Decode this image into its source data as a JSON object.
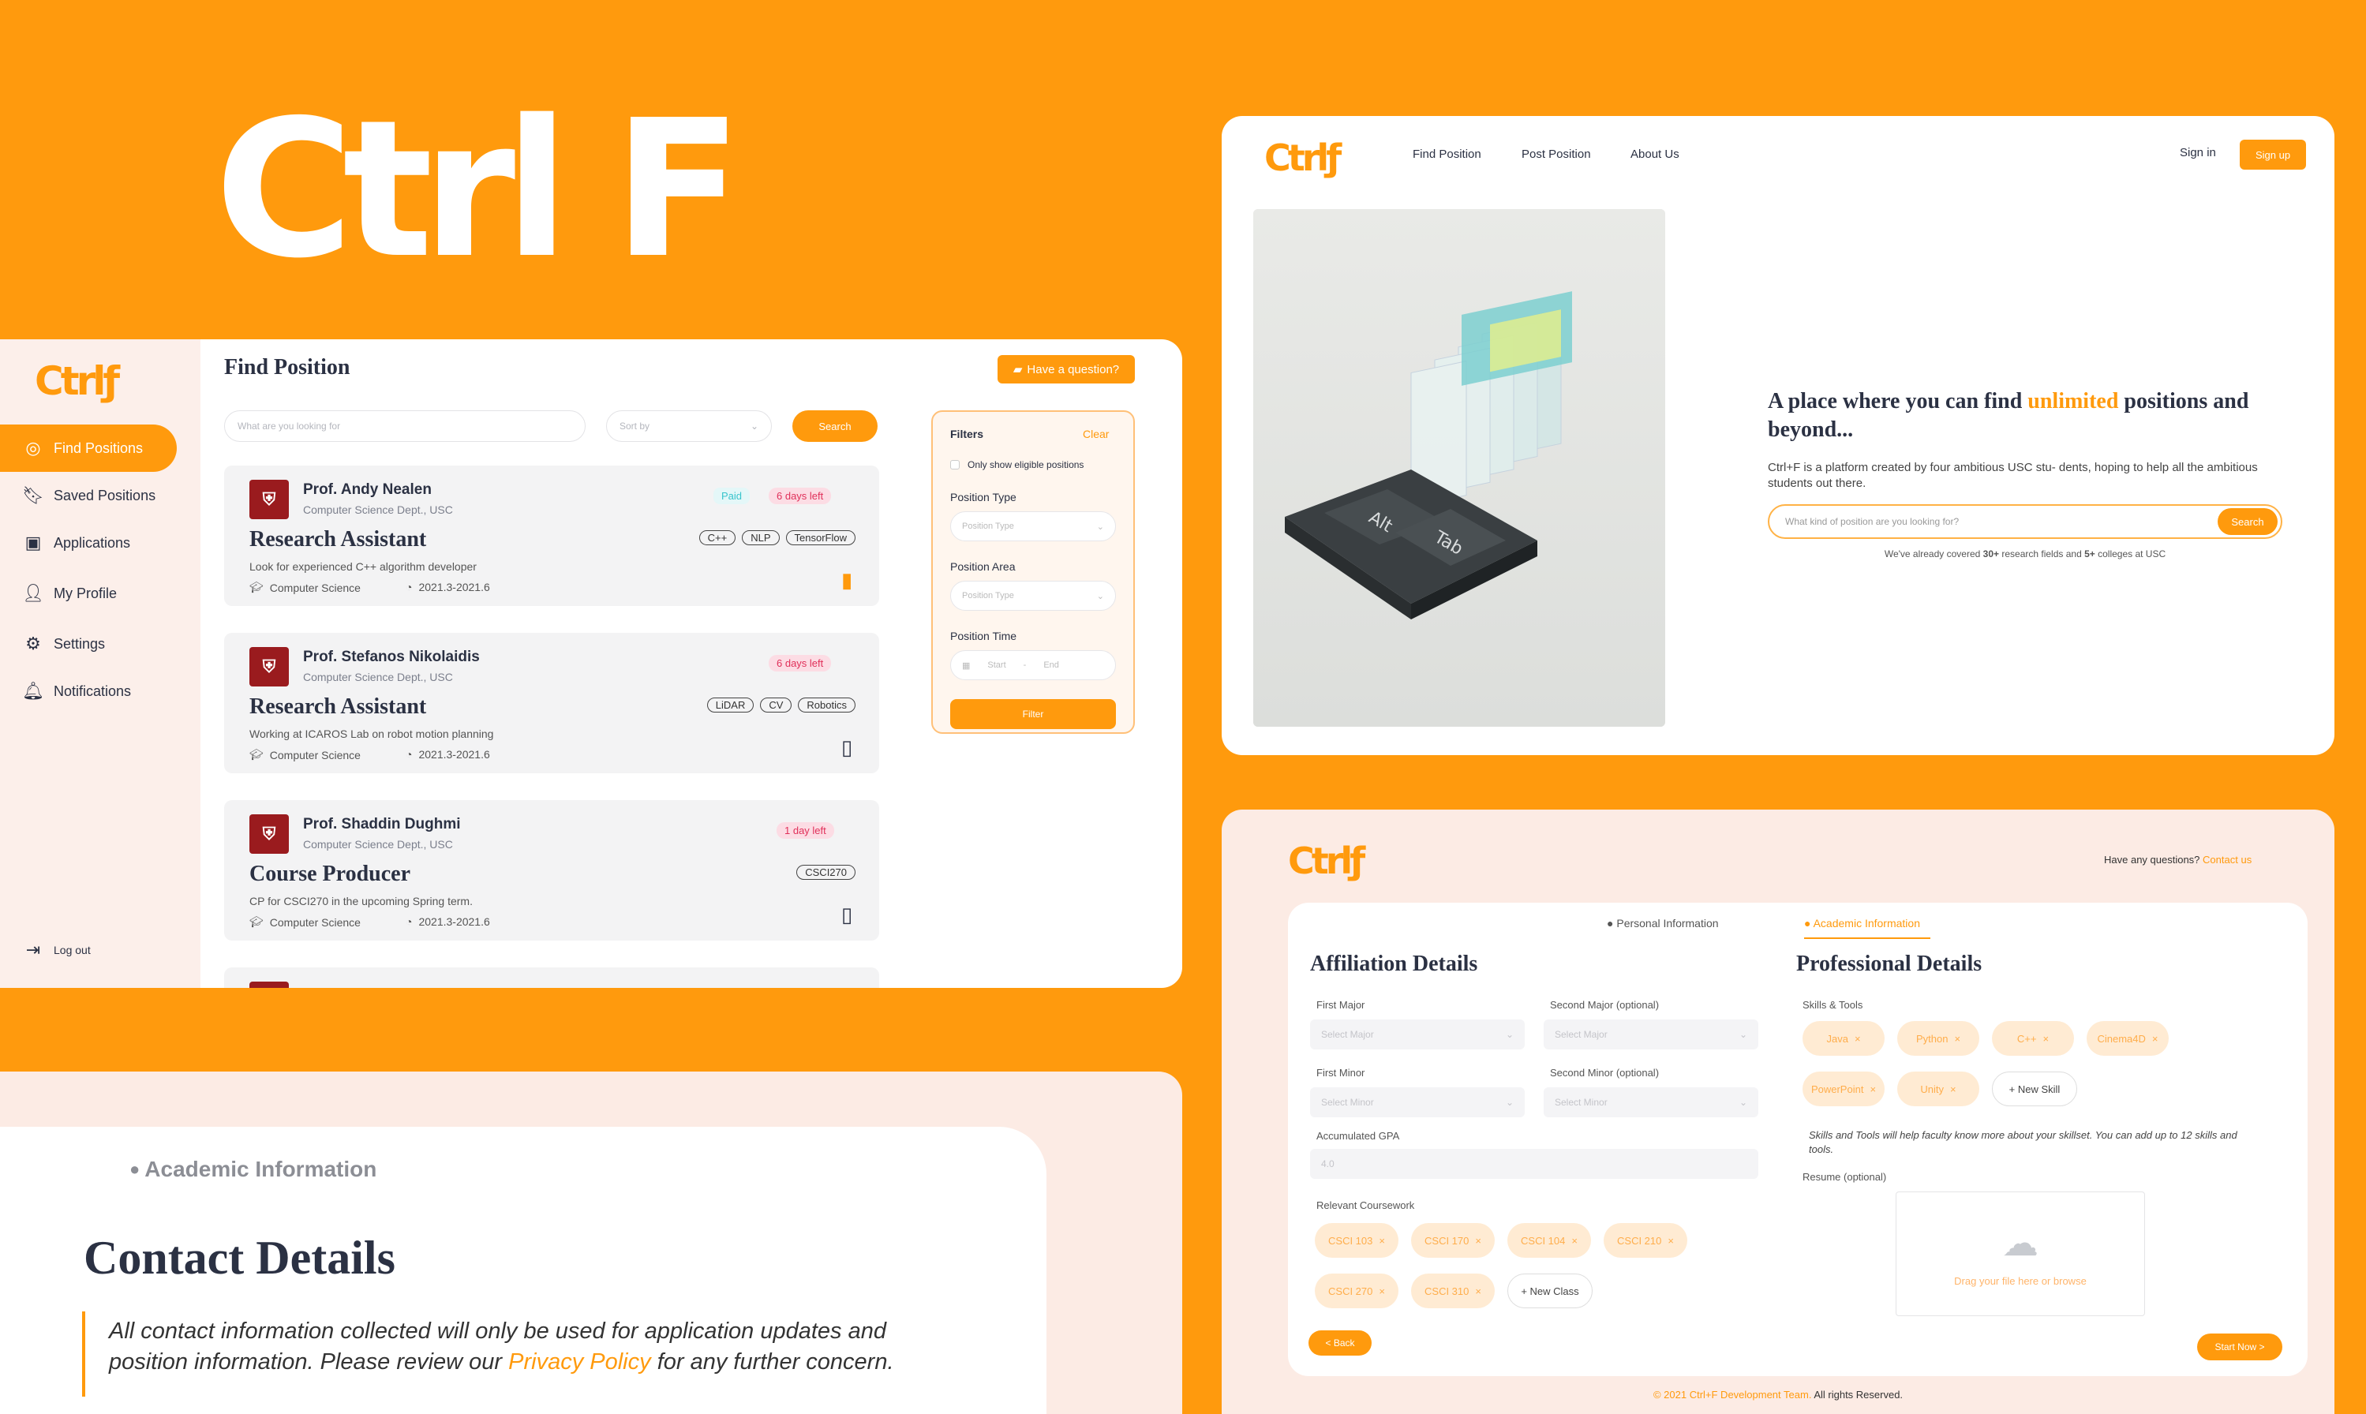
{
  "brand": {
    "logo": "Ctrl F",
    "small_logo": "Ctrlƒ"
  },
  "colors": {
    "accent": "#FF9A0D",
    "ink": "#2B3143",
    "paid": "#38C4CC",
    "urgent": "#E0305A"
  },
  "find_app": {
    "sidebar": [
      {
        "icon": "target-icon",
        "label": "Find Positions"
      },
      {
        "icon": "bookmark-icon",
        "label": "Saved Positions"
      },
      {
        "icon": "document-check-icon",
        "label": "Applications"
      },
      {
        "icon": "user-icon",
        "label": "My Profile"
      },
      {
        "icon": "gear-icon",
        "label": "Settings"
      },
      {
        "icon": "bell-icon",
        "label": "Notifications"
      }
    ],
    "logout": "Log out",
    "title": "Find Position",
    "ask_button": "Have a question?",
    "search_placeholder": "What are you looking for",
    "sort_placeholder": "Sort by",
    "search_button": "Search",
    "positions": [
      {
        "prof": "Prof. Andy Nealen",
        "dept": "Computer Science Dept., USC",
        "role": "Research Assistant",
        "desc": "Look for experienced C++ algorithm developer",
        "area": "Computer Science",
        "time": "2021.3-2021.6",
        "paid": "Paid",
        "deadline": "6 days left",
        "chips": [
          "C++",
          "NLP",
          "TensorFlow"
        ],
        "saved": true
      },
      {
        "prof": "Prof. Stefanos Nikolaidis",
        "dept": "Computer Science Dept., USC",
        "role": "Research Assistant",
        "desc": "Working at ICAROS Lab on robot motion planning",
        "area": "Computer Science",
        "time": "2021.3-2021.6",
        "paid": "",
        "deadline": "6 days left",
        "chips": [
          "LiDAR",
          "CV",
          "Robotics"
        ],
        "saved": false
      },
      {
        "prof": "Prof. Shaddin Dughmi",
        "dept": "Computer Science Dept., USC",
        "role": "Course Producer",
        "desc": "CP for CSCI270 in the upcoming Spring term.",
        "area": "Computer Science",
        "time": "2021.3-2021.6",
        "paid": "",
        "deadline": "1 day left",
        "chips": [
          "CSCI270"
        ],
        "saved": false
      }
    ],
    "filters": {
      "title": "Filters",
      "clear": "Clear",
      "eligible": "Only show eligible positions",
      "type_label": "Position Type",
      "type_placeholder": "Position Type",
      "area_label": "Position Area",
      "area_placeholder": "Position Type",
      "time_label": "Position Time",
      "start": "Start",
      "end": "End",
      "button": "Filter"
    }
  },
  "landing": {
    "nav": [
      "Find Position",
      "Post Position",
      "About Us"
    ],
    "sign_in": "Sign in",
    "sign_up": "Sign up",
    "heading_pre": "A place where you can find ",
    "heading_em": "unlimited",
    "heading_post": " positions and beyond...",
    "body": "Ctrl+F is a platform created by four ambitious USC stu- dents, hoping to help all the ambitious students out there.",
    "search_placeholder": "What kind of position are you looking for?",
    "search_button": "Search",
    "note_pre": "We've already covered ",
    "note_b1": "30+",
    "note_mid": " research fields and ",
    "note_b2": "5+",
    "note_post": " colleges at USC",
    "keys": [
      "Alt",
      "Tab"
    ]
  },
  "contact": {
    "section": "Academic Information",
    "title": "Contact Details",
    "note_pre": "All contact information collected will only be used for application updates and position information. Please review our ",
    "note_link": "Privacy Policy",
    "note_post": " for any further concern."
  },
  "academic": {
    "help": "Have any questions?",
    "help_link": "Contact us",
    "tabs": [
      "Personal Information",
      "Academic Information"
    ],
    "affiliation_title": "Affiliation Details",
    "first_major": "First Major",
    "second_major": "Second Major (optional)",
    "major_placeholder": "Select Major",
    "first_minor": "First Minor",
    "second_minor": "Second Minor (optional)",
    "minor_placeholder": "Select Minor",
    "gpa_label": "Accumulated GPA",
    "gpa_value": "4.0",
    "coursework_label": "Relevant Coursework",
    "courses": [
      "CSCI 103",
      "CSCI 170",
      "CSCI 104",
      "CSCI 210",
      "CSCI 270",
      "CSCI 310"
    ],
    "new_class": "+ New Class",
    "professional_title": "Professional Details",
    "skills_label": "Skills & Tools",
    "skills": [
      "Java",
      "Python",
      "C++",
      "Cinema4D",
      "PowerPoint",
      "Unity"
    ],
    "new_skill": "+ New Skill",
    "skills_hint": "Skills and Tools will help faculty know more about your skillset. You can add up to 12 skills and tools.",
    "resume_label": "Resume (optional)",
    "upload_text": "Drag your file here or browse",
    "back": "< Back",
    "start": "Start Now >",
    "footer_pre": "© ",
    "footer_link": "2021 Ctrl+F Development Team.",
    "footer_post": " All rights Reserved."
  }
}
